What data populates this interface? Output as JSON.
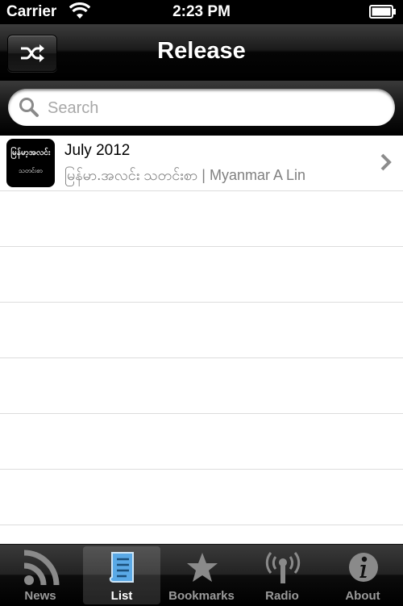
{
  "status_bar": {
    "carrier": "Carrier",
    "time": "2:23 PM",
    "wifi_icon": "wifi-icon",
    "battery_icon": "battery-icon"
  },
  "nav": {
    "title": "Release",
    "left_button_icon": "shuffle-icon"
  },
  "search": {
    "placeholder": "Search",
    "value": ""
  },
  "list": {
    "items": [
      {
        "title": "July 2012",
        "subtitle": "မြန်မာ.အလင်း သတင်းစာ | Myanmar A Lin",
        "thumbnail_line1": "မြန်မာ့အလင်း",
        "thumbnail_line2": "သတင်းစာ",
        "icon": "chevron-right-icon"
      }
    ]
  },
  "tab_bar": {
    "tabs": [
      {
        "label": "News",
        "icon": "rss-icon",
        "selected": false
      },
      {
        "label": "List",
        "icon": "list-scroll-icon",
        "selected": true
      },
      {
        "label": "Bookmarks",
        "icon": "star-icon",
        "selected": false
      },
      {
        "label": "Radio",
        "icon": "radio-antenna-icon",
        "selected": false
      },
      {
        "label": "About",
        "icon": "info-icon",
        "selected": false
      }
    ]
  },
  "colors": {
    "bar_background": "#000000",
    "list_background": "#ffffff",
    "separator": "#dcdcdc",
    "subtitle_text": "#808080",
    "tab_inactive": "#9a9a9a",
    "tab_active": "#ffffff",
    "tab_active_icon": "#5aa9e6"
  }
}
